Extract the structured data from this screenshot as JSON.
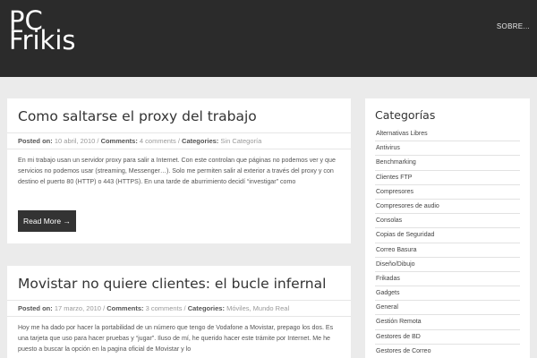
{
  "header": {
    "logo_line1": "PC",
    "logo_line2": "Frikis",
    "nav_item": "SOBRE..."
  },
  "posts": [
    {
      "title": "Como saltarse el proxy del trabajo",
      "posted_on_label": "Posted on:",
      "date": "10 abril, 2010",
      "comments_label": "Comments:",
      "comments": "4 comments",
      "categories_label": "Categories:",
      "categories": "Sin Categoría",
      "excerpt": "En mi trabajo usan un servidor proxy para salir a Internet. Con este controlan que páginas no podemos ver y que servicios no podemos usar (streaming, Messenger…). Solo me permiten salir al exterior a través del proxy y con destino el puerto 80 (HTTP) o 443 (HTTPS). En una tarde de aburrimiento decidí “investigar” como",
      "read_more": "Read More →"
    },
    {
      "title": "Movistar no quiere clientes: el bucle infernal",
      "posted_on_label": "Posted on:",
      "date": "17 marzo, 2010",
      "comments_label": "Comments:",
      "comments": "3 comments",
      "categories_label": "Categories:",
      "categories": "Móviles, Mundo Real",
      "excerpt": "Hoy me ha dado por hacer la portabilidad de un número que tengo de Vodafone a Movistar, prepago los dos. Es una tarjeta que uso para hacer pruebas y “jugar”. Iluso de mí, he querido hacer este trámite por Internet. Me he puesto a buscar la opción en la pagina oficial de Movistar y lo"
    }
  ],
  "sidebar": {
    "title": "Categorías",
    "items": [
      "Alternativas Libres",
      "Antivirus",
      "Benchmarking",
      "Clientes FTP",
      "Compresores",
      "Compresores de audio",
      "Consolas",
      "Copias de Seguridad",
      "Correo Basura",
      "Diseño/Dibujo",
      "Frikadas",
      "Gadgets",
      "General",
      "Gestión Remota",
      "Gestores de BD",
      "Gestores de Correo"
    ]
  }
}
